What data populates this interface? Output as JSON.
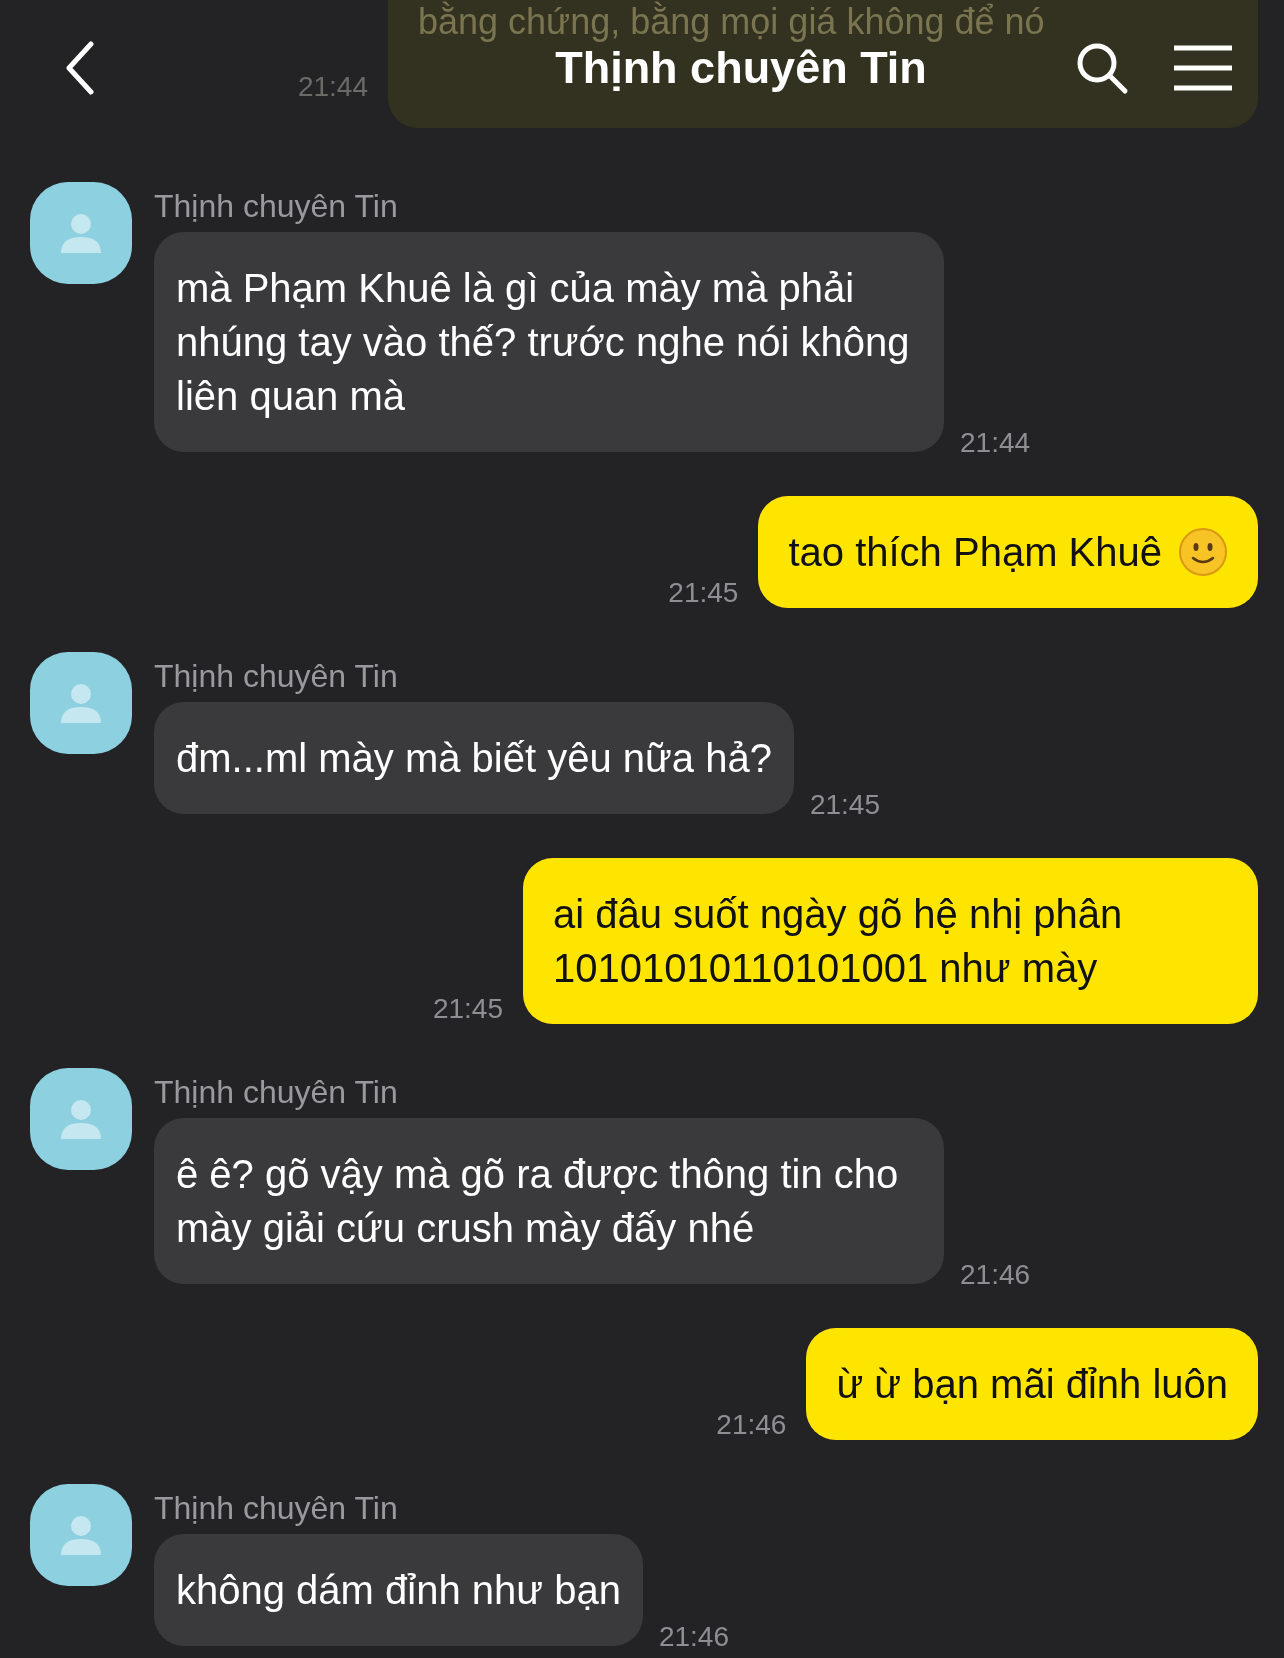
{
  "header": {
    "title": "Thịnh chuyên Tin"
  },
  "messages": [
    {
      "kind": "partial",
      "text": "bằng chứng, bằng mọi giá không để nó",
      "time": "21:44"
    },
    {
      "kind": "received",
      "sender": "Thịnh chuyên Tin",
      "text": "mà Phạm Khuê là gì của mày mà phải nhúng tay vào thế? trước nghe nói không liên quan mà",
      "time": "21:44"
    },
    {
      "kind": "sent",
      "text": "tao thích Phạm Khuê",
      "emoji": true,
      "time": "21:45"
    },
    {
      "kind": "received",
      "sender": "Thịnh chuyên Tin",
      "text": "đm...ml mày mà biết yêu nữa hả?",
      "time": "21:45"
    },
    {
      "kind": "sent",
      "text": "ai đâu suốt ngày gõ hệ nhị phân 10101010110101001 như mày",
      "time": "21:45"
    },
    {
      "kind": "received",
      "sender": "Thịnh chuyên Tin",
      "text": "ê ê? gõ vậy mà gõ ra được thông tin cho mày giải cứu crush mày đấy nhé",
      "time": "21:46"
    },
    {
      "kind": "sent",
      "text": "ừ ừ bạn mãi đỉnh luôn",
      "time": "21:46"
    },
    {
      "kind": "received",
      "sender": "Thịnh chuyên Tin",
      "text": "không dám đỉnh như bạn",
      "time": "21:46"
    }
  ]
}
